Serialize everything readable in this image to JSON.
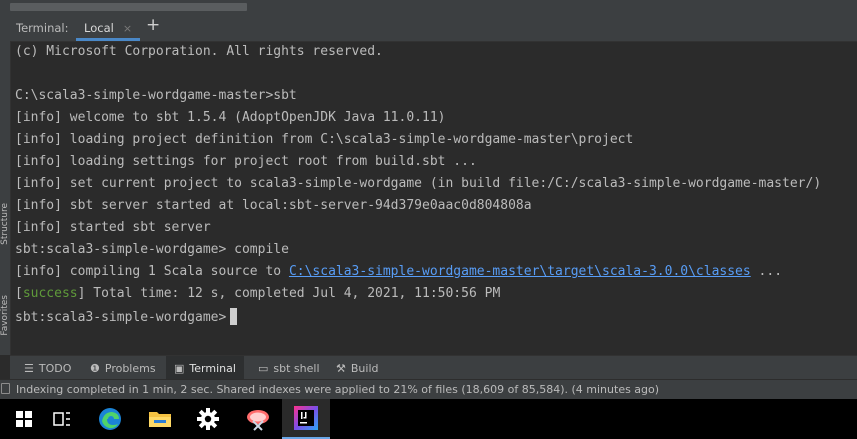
{
  "terminal_panel": {
    "title": "Terminal:",
    "tab_label": "Local",
    "tab_close": "×",
    "add_tab": "+"
  },
  "terminal_lines": {
    "l1": "(c) Microsoft Corporation. All rights reserved.",
    "l2": "C:\\scala3-simple-wordgame-master>sbt",
    "l3": "[info] welcome to sbt 1.5.4 (AdoptOpenJDK Java 11.0.11)",
    "l4": "[info] loading project definition from C:\\scala3-simple-wordgame-master\\project",
    "l5": "[info] loading settings for project root from build.sbt ...",
    "l6": "[info] set current project to scala3-simple-wordgame (in build file:/C:/scala3-simple-wordgame-master/)",
    "l7": "[info] sbt server started at local:sbt-server-94d379e0aac0d804808a",
    "l8": "[info] started sbt server",
    "l9": "sbt:scala3-simple-wordgame> compile",
    "l10_prefix": "[info] compiling 1 Scala source to ",
    "l10_link": "C:\\scala3-simple-wordgame-master\\target\\scala-3.0.0\\classes",
    "l10_suffix": " ...",
    "l11_tag": "success",
    "l11_rest": "] Total time: 12 s, completed Jul 4, 2021, 11:50:56 PM",
    "l12": "sbt:scala3-simple-wordgame>"
  },
  "side_labels": {
    "structure": "Structure",
    "favorites": "Favorites"
  },
  "tool_windows": {
    "todo": "TODO",
    "problems": "Problems",
    "terminal": "Terminal",
    "sbt_shell": "sbt shell",
    "build": "Build"
  },
  "status": {
    "message": "Indexing completed in 1 min, 2 sec. Shared indexes were applied to 21% of files (18,609 of 85,584). (4 minutes ago)"
  },
  "taskbar": {
    "items": [
      "windows-start",
      "task-view",
      "edge",
      "file-explorer",
      "settings",
      "snipping-tool",
      "intellij-idea"
    ]
  },
  "colors": {
    "terminal_bg": "#2b2b2b",
    "panel_bg": "#3c3f41",
    "text": "#bbbbbb",
    "link": "#589df6",
    "success": "#5f9a3a",
    "accent": "#4a88c7"
  }
}
